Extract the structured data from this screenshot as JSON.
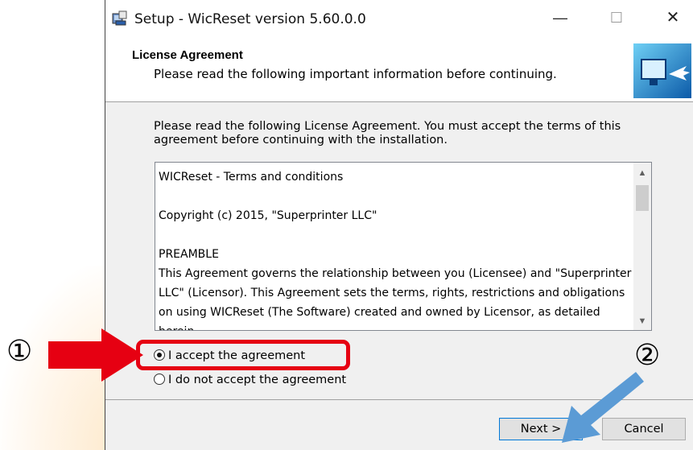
{
  "window": {
    "title": "Setup - WicReset version 5.60.0.0",
    "controls": {
      "minimize": "—",
      "maximize": "☐",
      "close": "✕"
    }
  },
  "header": {
    "title": "License Agreement",
    "subtitle": "Please read the following important information before continuing."
  },
  "intro": "Please read the following License Agreement. You must accept the terms of this agreement before continuing with the installation.",
  "license": {
    "text": "WICReset - Terms and conditions\n\nCopyright (c) 2015, \"Superprinter LLC\"\n\nPREAMBLE\nThis Agreement governs the relationship between you (Licensee) and \"Superprinter LLC\" (Licensor). This Agreement sets the terms, rights, restrictions and obligations on using WICReset (The Software) created and owned by Licensor, as detailed herein"
  },
  "options": {
    "accept": "I accept the agreement",
    "decline": "I do not accept the agreement",
    "selected": "accept"
  },
  "buttons": {
    "next": "Next >",
    "cancel": "Cancel"
  },
  "annotations": {
    "step1": "①",
    "step2": "②"
  },
  "colors": {
    "highlight": "#e60012",
    "arrow_red": "#e60012",
    "arrow_blue": "#5b9bd5"
  }
}
